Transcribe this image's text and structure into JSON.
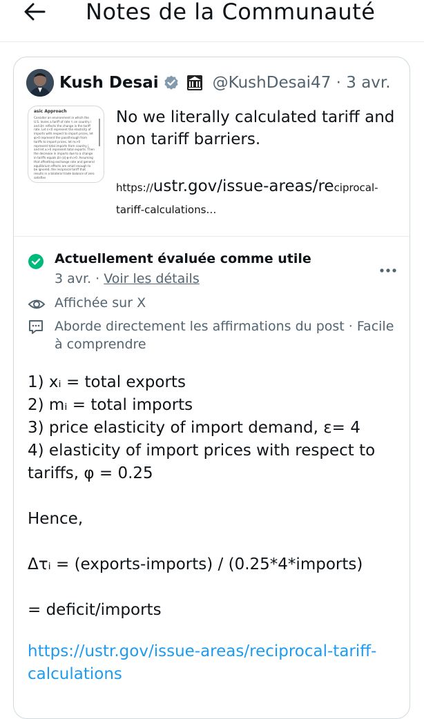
{
  "header": {
    "back_icon": "arrow-left-icon",
    "title": "Notes de la Communauté"
  },
  "post": {
    "author_name": "Kush Desai",
    "handle_date": "@KushDesai47 · 3 avr.",
    "verified_color": "#829aab",
    "thumbnail": {
      "title": "asic Approach",
      "text": "Consider an environment in which the U.S. levies a tariff of rate τᵢ on country i and Δτᵢ reflects the change in the tariff rate. Let ε<0 represent the elasticity of imports with respect to import prices, let φ>0 represent the passthrough from tariffs to import prices, let mᵢ>0 represent total imports from country i, and let xᵢ>0 represent total exports. Then the decrease in imports due to a change in tariffs equals Δτᵢ·|ε|·φ·mᵢ>0. Assuming that offsetting exchange rate and general equilibrium effects are small enough to be ignored, the reciprocal tariff that results in a bilateral trade balance of zero satisfies"
    },
    "text": "No we literally calculated tariff and non tariff barriers.",
    "link_prefix": "https://",
    "link_main": "ustr.gov/issue-areas/re",
    "link_suffix": "ciprocal-tariff-calculations…"
  },
  "note": {
    "status_icon": "check-circle-icon",
    "status_color": "#00ba7c",
    "status_title": "Actuellement évaluée comme utile",
    "date": "3 avr.",
    "meta_separator": " · ",
    "details_link": "Voir les détails",
    "more_icon": "more-horizontal-icon",
    "shown_icon": "eye-icon",
    "shown_on": "Affichée sur X",
    "addresses_icon": "comment-icon",
    "addresses_text": "Aborde directement les affirmations du post · Facile à comprendre",
    "body_lines": [
      "1) xᵢ = total exports",
      "2) mᵢ = total imports",
      "3) price elasticity of import demand, ε= 4",
      "4) elasticity of import prices with respect to tariffs, φ = 0.25",
      "Hence,",
      "Δτᵢ = (exports-imports) / (0.25*4*imports)",
      "= deficit/imports"
    ],
    "source_link": "https://ustr.gov/issue-areas/reciprocal-tariff-calculations",
    "link_color": "#1d9bf0"
  }
}
